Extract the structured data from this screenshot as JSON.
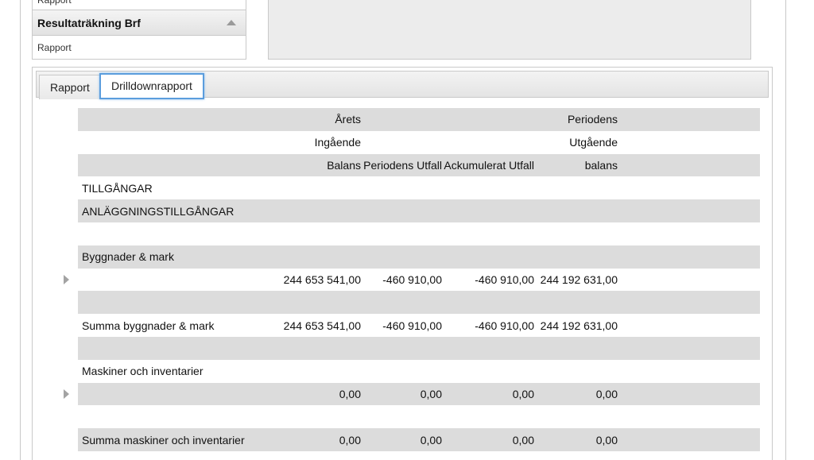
{
  "accordion": {
    "top_item": "Rapport",
    "header": "Resultaträkning Brf",
    "item": "Rapport"
  },
  "tabs": [
    {
      "label": "Rapport",
      "active": false
    },
    {
      "label": "Drilldownrapport",
      "active": true
    }
  ],
  "report": {
    "header_rows": [
      [
        "",
        "Årets",
        "",
        "",
        "Periodens"
      ],
      [
        "",
        "Ingående",
        "",
        "",
        "Utgående"
      ],
      [
        "",
        "Balans",
        "Periodens Utfall",
        "Ackumulerat Utfall",
        "balans"
      ]
    ],
    "rows": [
      {
        "label": "TILLGÅNGAR",
        "values": [
          "",
          "",
          "",
          ""
        ]
      },
      {
        "label": "ANLÄGGNINGSTILLGÅNGAR",
        "values": [
          "",
          "",
          "",
          ""
        ]
      },
      {
        "label": "",
        "values": [
          "",
          "",
          "",
          ""
        ]
      },
      {
        "label": "Byggnader & mark",
        "values": [
          "",
          "",
          "",
          ""
        ]
      },
      {
        "label": "",
        "values": [
          "244 653 541,00",
          "-460 910,00",
          "-460 910,00",
          "244 192 631,00"
        ],
        "expandable": true
      },
      {
        "label": "",
        "values": [
          "",
          "",
          "",
          ""
        ]
      },
      {
        "label": "Summa byggnader &  mark",
        "values": [
          "244 653 541,00",
          "-460 910,00",
          "-460 910,00",
          "244 192 631,00"
        ]
      },
      {
        "label": "",
        "values": [
          "",
          "",
          "",
          ""
        ]
      },
      {
        "label": "Maskiner och inventarier",
        "values": [
          "",
          "",
          "",
          ""
        ]
      },
      {
        "label": "",
        "values": [
          "0,00",
          "0,00",
          "0,00",
          "0,00"
        ],
        "expandable": true
      },
      {
        "label": "",
        "values": [
          "",
          "",
          "",
          ""
        ]
      },
      {
        "label": "Summa maskiner och inventarier",
        "values": [
          "0,00",
          "0,00",
          "0,00",
          "0,00"
        ]
      }
    ]
  }
}
